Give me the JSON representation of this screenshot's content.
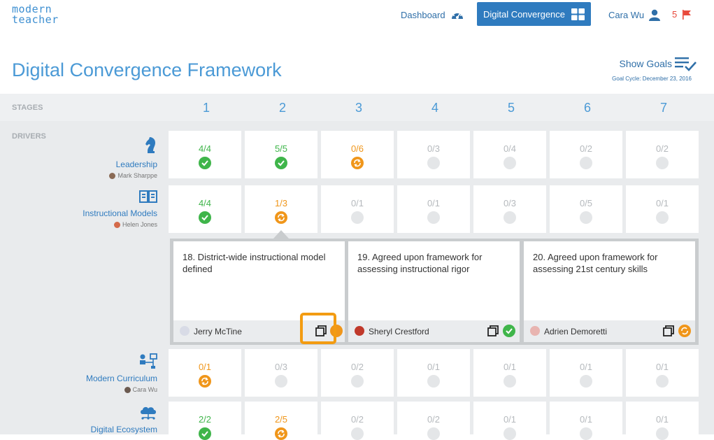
{
  "header": {
    "logo_line1": "modern",
    "logo_line2": "teacher",
    "dashboard_label": "Dashboard",
    "active_button_label": "Digital Convergence",
    "user_name": "Cara Wu",
    "flag_count": "5"
  },
  "page": {
    "title": "Digital Convergence Framework",
    "show_goals_label": "Show Goals",
    "goal_cycle": "Goal Cycle: December 23, 2016"
  },
  "grid": {
    "stages_label": "STAGES",
    "drivers_label": "DRIVERS",
    "stages": [
      "1",
      "2",
      "3",
      "4",
      "5",
      "6",
      "7"
    ]
  },
  "drivers": [
    {
      "name": "Leadership",
      "owner": "Mark Sharppe",
      "icon": "chess-knight-icon",
      "cells": [
        {
          "value": "4/4",
          "status": "green"
        },
        {
          "value": "5/5",
          "status": "green"
        },
        {
          "value": "0/6",
          "status": "orange"
        },
        {
          "value": "0/3",
          "status": "gray"
        },
        {
          "value": "0/4",
          "status": "gray"
        },
        {
          "value": "0/2",
          "status": "gray"
        },
        {
          "value": "0/2",
          "status": "gray"
        }
      ]
    },
    {
      "name": "Instructional Models",
      "owner": "Helen Jones",
      "icon": "book-icon",
      "cells": [
        {
          "value": "4/4",
          "status": "green"
        },
        {
          "value": "1/3",
          "status": "orange"
        },
        {
          "value": "0/1",
          "status": "gray"
        },
        {
          "value": "0/1",
          "status": "gray"
        },
        {
          "value": "0/3",
          "status": "gray"
        },
        {
          "value": "0/5",
          "status": "gray"
        },
        {
          "value": "0/1",
          "status": "gray"
        }
      ]
    },
    {
      "name": "Modern Curriculum",
      "owner": "Cara Wu",
      "icon": "hierarchy-icon",
      "cells": [
        {
          "value": "0/1",
          "status": "orange"
        },
        {
          "value": "0/3",
          "status": "gray"
        },
        {
          "value": "0/2",
          "status": "gray"
        },
        {
          "value": "0/1",
          "status": "gray"
        },
        {
          "value": "0/1",
          "status": "gray"
        },
        {
          "value": "0/1",
          "status": "gray"
        },
        {
          "value": "0/1",
          "status": "gray"
        }
      ]
    },
    {
      "name": "Digital Ecosystem",
      "owner": "",
      "icon": "cloud-network-icon",
      "cells": [
        {
          "value": "2/2",
          "status": "green"
        },
        {
          "value": "2/5",
          "status": "orange"
        },
        {
          "value": "0/2",
          "status": "gray"
        },
        {
          "value": "0/2",
          "status": "gray"
        },
        {
          "value": "0/1",
          "status": "gray"
        },
        {
          "value": "0/1",
          "status": "gray"
        },
        {
          "value": "0/1",
          "status": "gray"
        }
      ]
    }
  ],
  "expanded_panel": {
    "cards": [
      {
        "title": "18. District-wide instructional model defined",
        "owner": "Jerry McTine",
        "status": "orange"
      },
      {
        "title": "19. Agreed upon framework for assessing instructional rigor",
        "owner": "Sheryl Crestford",
        "status": "green"
      },
      {
        "title": "20. Agreed upon framework for assessing 21st century skills",
        "owner": "Adrien Demoretti",
        "status": "orange"
      }
    ]
  },
  "colors": {
    "accent": "#2f7bbf",
    "green": "#3fb54a",
    "orange": "#f0961a",
    "highlight": "#f39c12",
    "flag": "#e84a3c"
  }
}
